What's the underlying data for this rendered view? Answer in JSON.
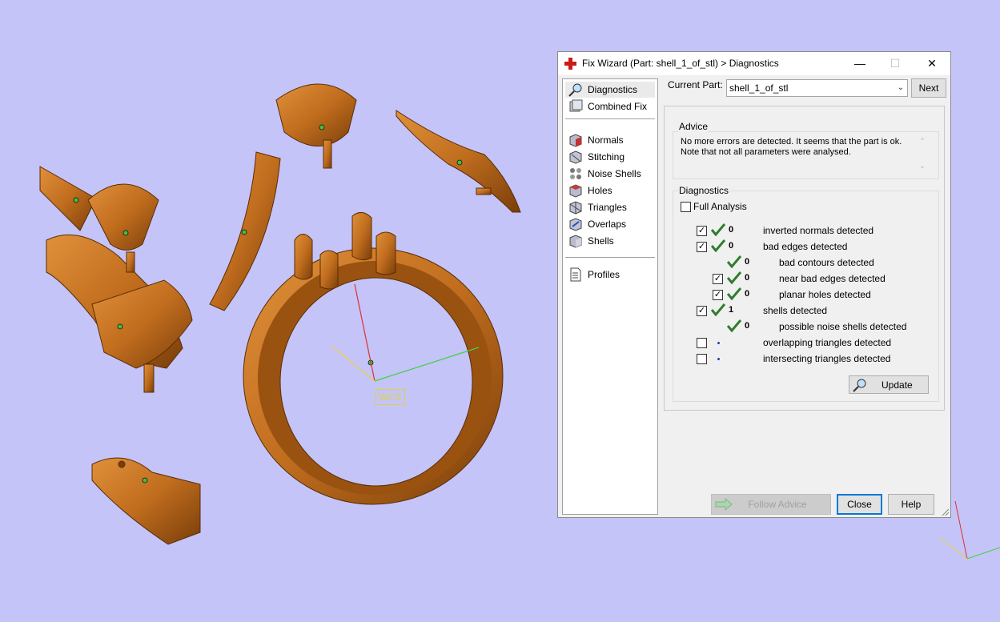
{
  "window": {
    "title": "Fix Wizard (Part: shell_1_of_stl) > Diagnostics",
    "minimize": "—",
    "maximize": "☐",
    "close": "✕"
  },
  "viewport": {
    "wcs_label": "WCS"
  },
  "sidebar": {
    "items": [
      {
        "label": "Diagnostics",
        "icon": "magnifier-icon",
        "selected": true
      },
      {
        "label": "Combined Fix",
        "icon": "combined-fix-icon"
      },
      {
        "label": "Normals",
        "icon": "normals-cube-icon"
      },
      {
        "label": "Stitching",
        "icon": "stitching-cube-icon"
      },
      {
        "label": "Noise Shells",
        "icon": "noise-shells-icon"
      },
      {
        "label": "Holes",
        "icon": "holes-cube-icon"
      },
      {
        "label": "Triangles",
        "icon": "triangles-cube-icon"
      },
      {
        "label": "Overlaps",
        "icon": "overlaps-cube-icon"
      },
      {
        "label": "Shells",
        "icon": "shells-cube-icon"
      },
      {
        "label": "Profiles",
        "icon": "document-icon"
      }
    ]
  },
  "part": {
    "label": "Current Part:",
    "value": "shell_1_of_stl",
    "next": "Next"
  },
  "advice": {
    "title": "Advice",
    "line1": "No more errors are detected. It seems that the part is ok.",
    "line2": "Note that not all parameters were analysed."
  },
  "diagnostics": {
    "title": "Diagnostics",
    "full_analysis": "Full Analysis",
    "rows": [
      {
        "count": "0",
        "label": "inverted normals detected"
      },
      {
        "count": "0",
        "label": "bad edges detected"
      },
      {
        "count": "0",
        "label": "bad contours detected"
      },
      {
        "count": "0",
        "label": "near bad edges detected"
      },
      {
        "count": "0",
        "label": "planar holes detected"
      },
      {
        "count": "1",
        "label": "shells detected"
      },
      {
        "count": "0",
        "label": "possible noise shells detected"
      },
      {
        "count": "",
        "label": "overlapping triangles detected"
      },
      {
        "count": "",
        "label": "intersecting triangles detected"
      }
    ],
    "update": "Update"
  },
  "footer": {
    "follow_advice": "Follow Advice",
    "close": "Close",
    "help": "Help"
  },
  "colors": {
    "background": "#c4c4f8",
    "model": "#c8741c",
    "check": "#2e7d32"
  }
}
